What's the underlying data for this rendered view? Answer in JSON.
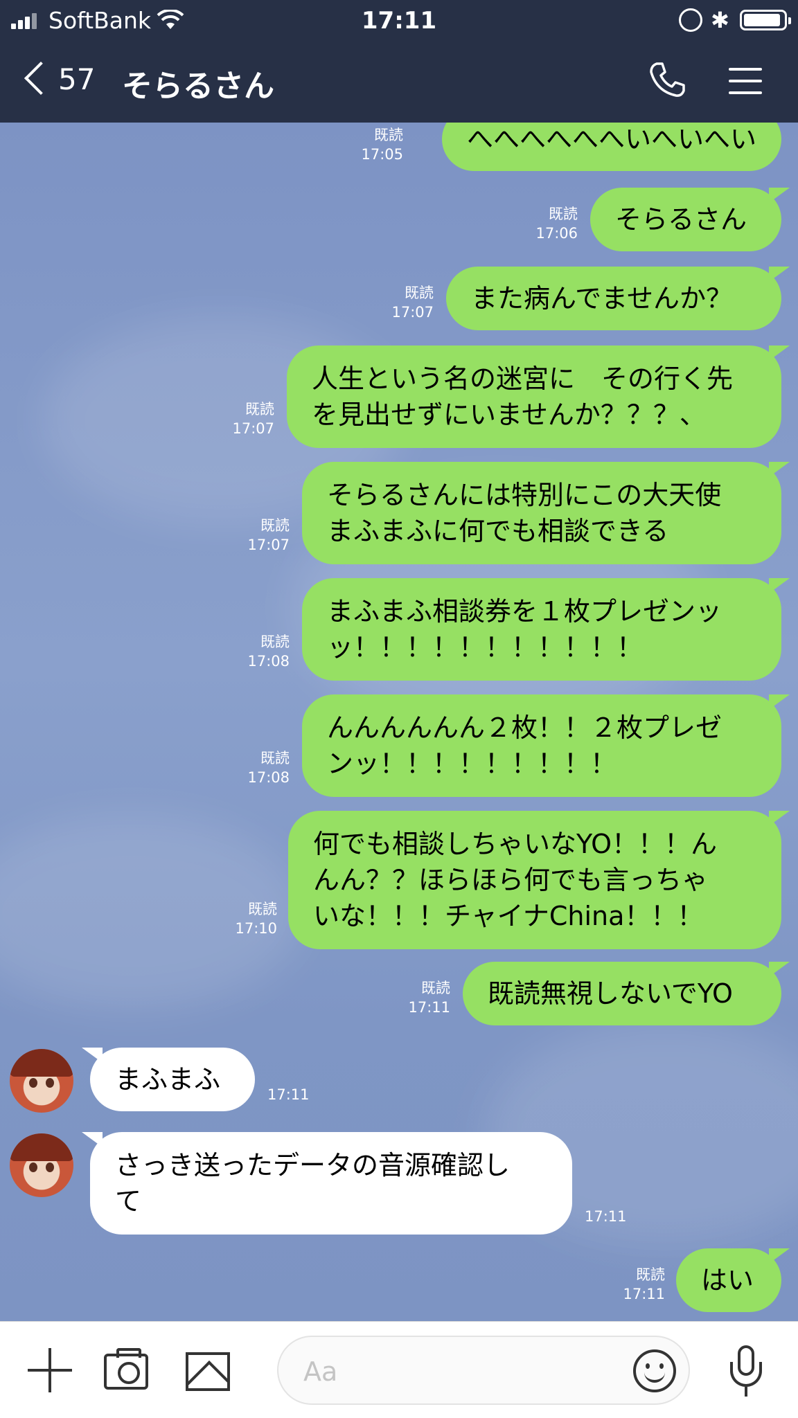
{
  "status_bar": {
    "carrier": "SoftBank",
    "time": "17:11"
  },
  "header": {
    "back_count": "57",
    "title": "そらるさん"
  },
  "messages_out": [
    {
      "text": "へへへへへへいへいへい",
      "read": "既読",
      "time": "17:05"
    },
    {
      "text": "そらるさん",
      "read": "既読",
      "time": "17:06"
    },
    {
      "text": "また病んでませんか？",
      "read": "既読",
      "time": "17:07"
    },
    {
      "text_line1": "人生という名の迷宮に　その行く先",
      "text_line2": "を見出せずにいませんか？？？、",
      "read": "既読",
      "time": "17:07"
    },
    {
      "text_line1": "そらるさんには特別にこの大天使",
      "text_line2": "まふまふに何でも相談できる",
      "read": "既読",
      "time": "17:07"
    },
    {
      "text_line1": "まふまふ相談券を１枚プレゼンッ",
      "text_line2": "ッ！！！！！！！！！！！",
      "read": "既読",
      "time": "17:08"
    },
    {
      "text_line1": "んんんんんん２枚！！２枚プレゼ",
      "text_line2": "ンッ！！！！！！！！！",
      "read": "既読",
      "time": "17:08"
    },
    {
      "text_line1": "何でも相談しちゃいなYO！！！ん",
      "text_line2": "んん？？ほらほら何でも言っちゃ",
      "text_line3": "いな！！！チャイナChina！！！",
      "read": "既読",
      "time": "17:10"
    },
    {
      "text": "既読無視しないでYO",
      "read": "既読",
      "time": "17:11"
    }
  ],
  "messages_in": [
    {
      "text": "まふまふ",
      "time": "17:11"
    },
    {
      "text_line1": "さっき送ったデータの音源確認し",
      "text_line2": "て",
      "time": "17:11"
    }
  ],
  "last_out": {
    "text": "はい",
    "read": "既読",
    "time": "17:11"
  },
  "input": {
    "placeholder": "Aa"
  },
  "icons": {
    "back": "chevron-left-icon",
    "call": "phone-icon",
    "menu": "hamburger-menu-icon",
    "add": "plus-icon",
    "camera": "camera-icon",
    "image": "image-icon",
    "emoji": "emoji-icon",
    "mic": "microphone-icon"
  },
  "colors": {
    "header_bg": "#273046",
    "outgoing_bubble": "#96e063",
    "incoming_bubble": "#ffffff",
    "chat_bg": "#7d93c4"
  }
}
